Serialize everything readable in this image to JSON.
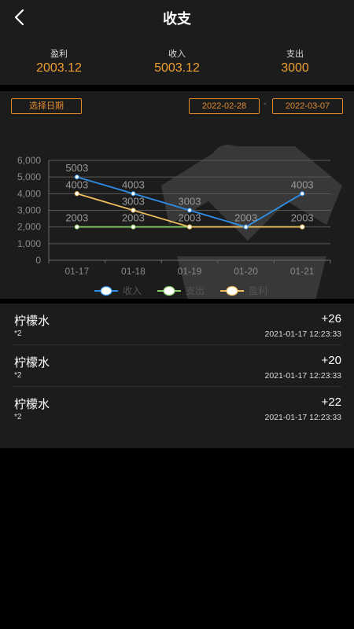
{
  "header": {
    "title": "收支",
    "back_icon": "chevron-left-icon"
  },
  "stats": [
    {
      "label": "盈利",
      "value": "2003.12"
    },
    {
      "label": "收入",
      "value": "5003.12"
    },
    {
      "label": "支出",
      "value": "3000"
    }
  ],
  "date_filter": {
    "pick_label": "选择日期",
    "start": "2022-02-28",
    "separator": "-",
    "end": "2022-03-07"
  },
  "colors": {
    "accent": "#f0a030",
    "income": "#2f8fe8",
    "expense": "#8cd26a",
    "profit": "#f0c060",
    "panel": "#1c1c1c"
  },
  "chart_data": {
    "type": "line",
    "categories": [
      "01-17",
      "01-18",
      "01-19",
      "01-20",
      "01-21"
    ],
    "ylim": [
      0,
      6000
    ],
    "yticks": [
      "0",
      "1,000",
      "2,000",
      "3,000",
      "4,000",
      "5,000",
      "6,000"
    ],
    "ytick_values": [
      0,
      1000,
      2000,
      3000,
      4000,
      5000,
      6000
    ],
    "grid": true,
    "legend_position": "bottom",
    "series": [
      {
        "name": "收入",
        "values": [
          5003,
          4003,
          3003,
          2003,
          4003
        ],
        "color": "#2f8fe8"
      },
      {
        "name": "支出",
        "values": [
          2003,
          2003,
          2003,
          2003,
          2003
        ],
        "color": "#8cd26a"
      },
      {
        "name": "盈利",
        "values": [
          4003,
          3003,
          2003,
          2003,
          2003
        ],
        "color": "#f0c060"
      }
    ],
    "data_labels": [
      {
        "category": "01-17",
        "labels": [
          "5003",
          "4003",
          "2003"
        ]
      },
      {
        "category": "01-18",
        "labels": [
          "4003",
          "3003",
          "2003"
        ]
      },
      {
        "category": "01-19",
        "labels": [
          "3003",
          "2003"
        ]
      },
      {
        "category": "01-20",
        "labels": [
          "2003"
        ]
      },
      {
        "category": "01-21",
        "labels": [
          "4003",
          "2003"
        ]
      }
    ]
  },
  "records": [
    {
      "name": "柠檬水",
      "qty": "*2",
      "amount": "+26",
      "time": "2021-01-17 12:23:33"
    },
    {
      "name": "柠檬水",
      "qty": "*2",
      "amount": "+20",
      "time": "2021-01-17 12:23:33"
    },
    {
      "name": "柠檬水",
      "qty": "*2",
      "amount": "+22",
      "time": "2021-01-17 12:23:33"
    }
  ]
}
